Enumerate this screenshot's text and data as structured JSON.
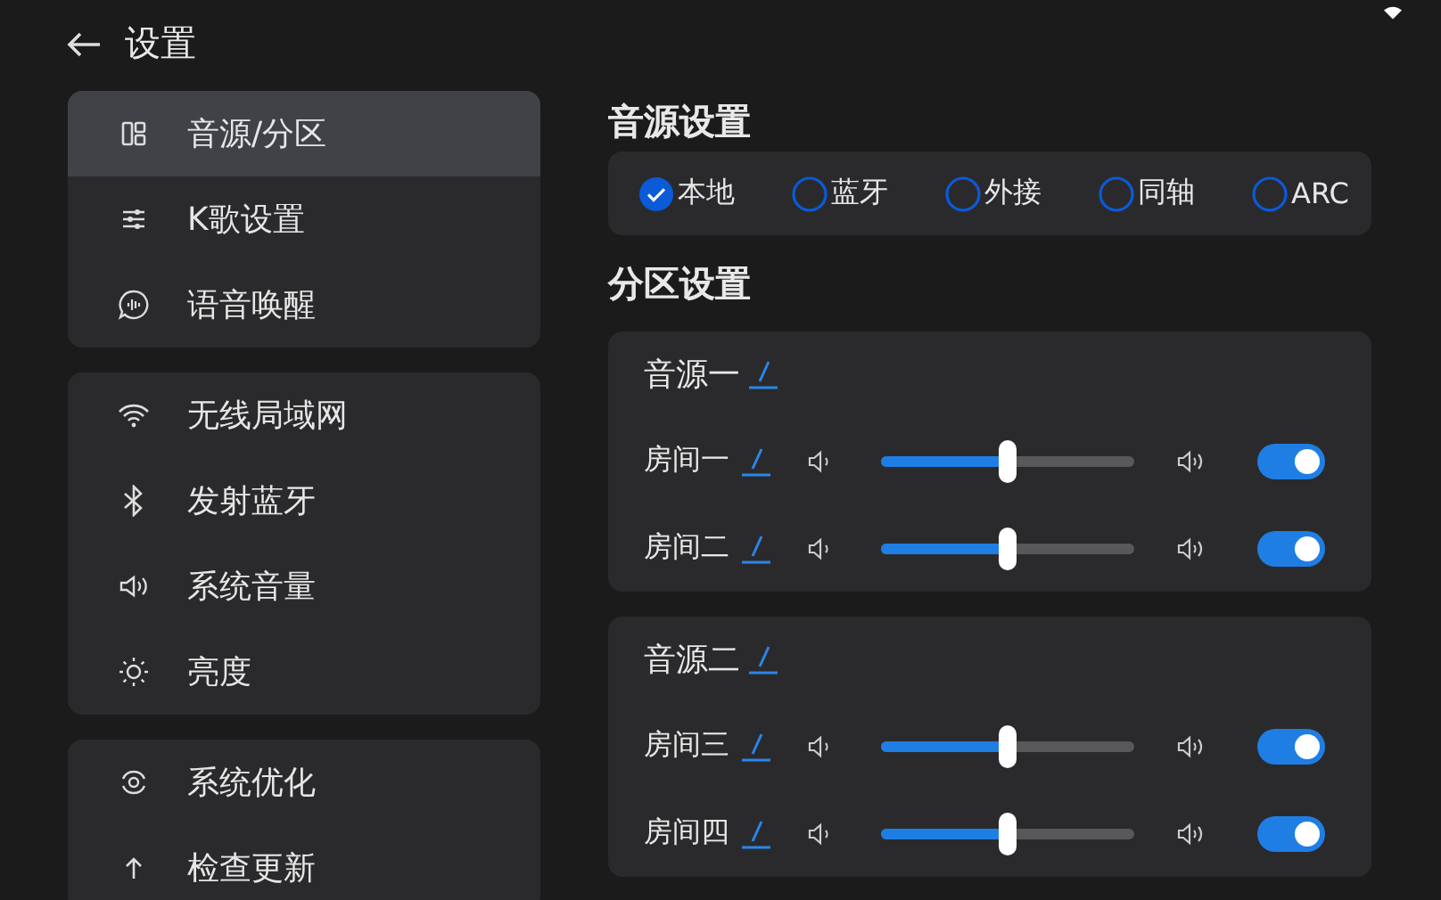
{
  "header": {
    "title": "设置"
  },
  "sidebar": {
    "groups": [
      {
        "items": [
          {
            "kind": "layout",
            "label": "音源/分区",
            "selected": true
          },
          {
            "kind": "sliders",
            "label": "K歌设置",
            "selected": false
          },
          {
            "kind": "voice",
            "label": "语音唤醒",
            "selected": false
          }
        ]
      },
      {
        "items": [
          {
            "kind": "wifi",
            "label": "无线局域网",
            "selected": false
          },
          {
            "kind": "bluetooth",
            "label": "发射蓝牙",
            "selected": false
          },
          {
            "kind": "volume",
            "label": "系统音量",
            "selected": false
          },
          {
            "kind": "brightness",
            "label": "亮度",
            "selected": false
          }
        ]
      },
      {
        "items": [
          {
            "kind": "optimize",
            "label": "系统优化",
            "selected": false
          },
          {
            "kind": "update",
            "label": "检查更新",
            "selected": false
          }
        ]
      }
    ]
  },
  "source_settings": {
    "title": "音源设置",
    "options": [
      {
        "label": "本地",
        "selected": true
      },
      {
        "label": "蓝牙",
        "selected": false
      },
      {
        "label": "外接",
        "selected": false
      },
      {
        "label": "同轴",
        "selected": false
      },
      {
        "label": "ARC",
        "selected": false
      }
    ]
  },
  "zone_settings": {
    "title": "分区设置",
    "zones": [
      {
        "name": "音源一",
        "rooms": [
          {
            "name": "房间一",
            "level": 0.5,
            "on": true
          },
          {
            "name": "房间二",
            "level": 0.5,
            "on": true
          }
        ]
      },
      {
        "name": "音源二",
        "rooms": [
          {
            "name": "房间三",
            "level": 0.5,
            "on": true
          },
          {
            "name": "房间四",
            "level": 0.5,
            "on": true
          }
        ]
      }
    ]
  }
}
